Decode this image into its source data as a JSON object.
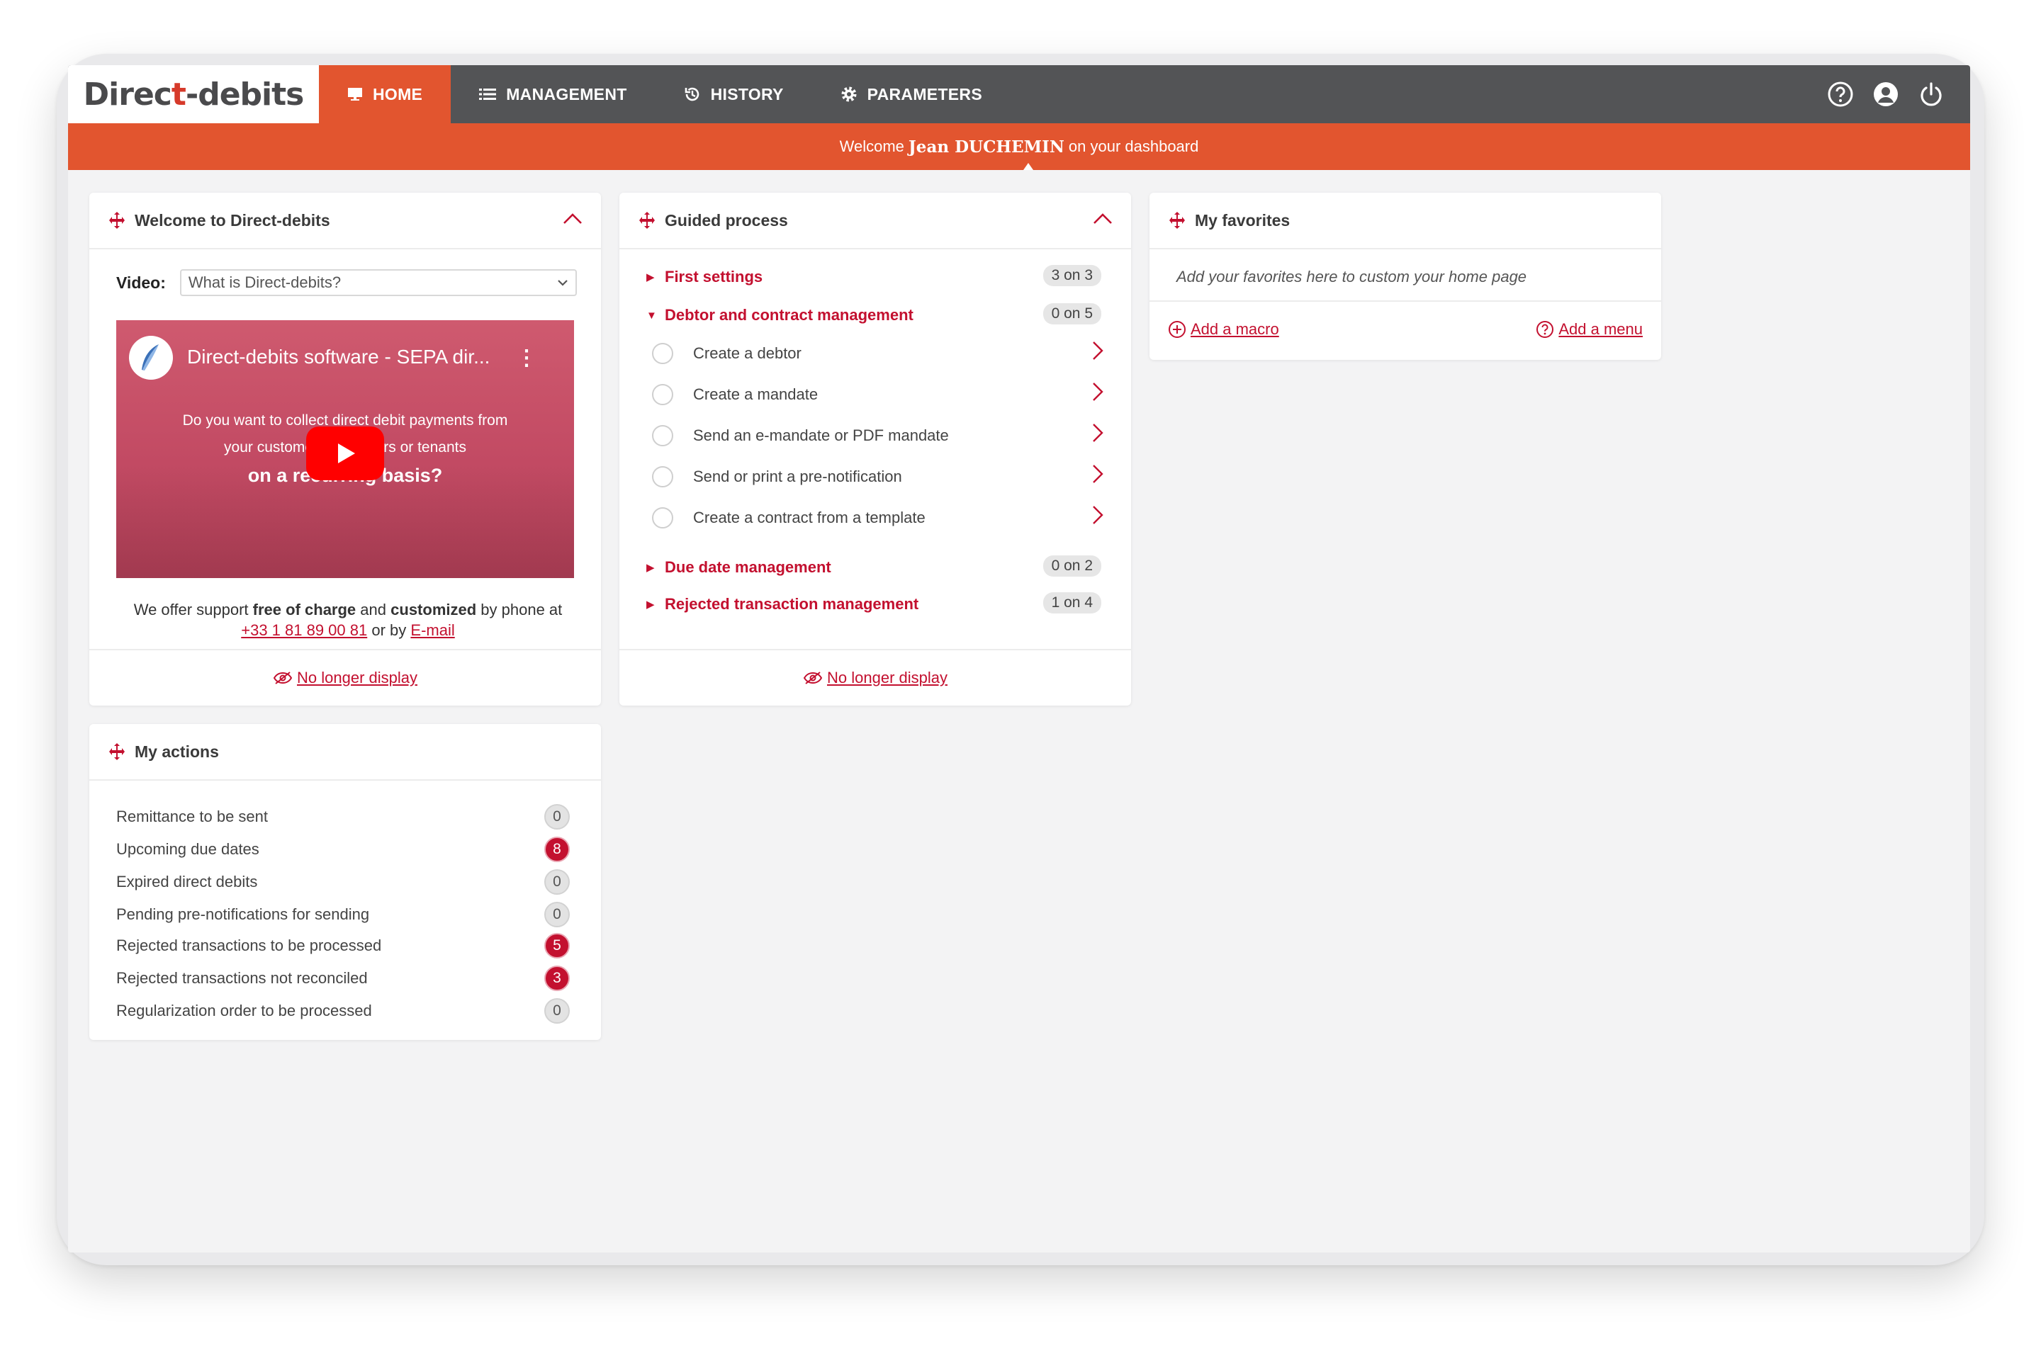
{
  "app": {
    "logo_a": "Direc",
    "logo_mark": "t",
    "logo_b": "-debits"
  },
  "nav": [
    {
      "label": "HOME",
      "icon": "monitor-icon",
      "active": true
    },
    {
      "label": "MANAGEMENT",
      "icon": "list-icon",
      "active": false
    },
    {
      "label": "HISTORY",
      "icon": "history-icon",
      "active": false
    },
    {
      "label": "PARAMETERS",
      "icon": "gear-icon",
      "active": false
    }
  ],
  "top_icons": [
    "help-icon",
    "user-icon",
    "power-icon"
  ],
  "welcome": {
    "prefix": "Welcome",
    "name": "Jean DUCHEMIN",
    "suffix": "on your dashboard"
  },
  "colors": {
    "accent": "#e2552f",
    "brand_red": "#c3102f",
    "topbar": "#535456"
  },
  "welcome_panel": {
    "title": "Welcome to Direct-debits",
    "video_label": "Video:",
    "video_selected": "What is Direct-debits?",
    "video_title": "Direct-debits software - SEPA dir...",
    "video_line1": "Do you want to collect direct debit payments from",
    "video_line2": "your customers, members or tenants",
    "video_line3": "on a recurring basis?",
    "support_1": "We offer support",
    "support_2": "free of charge",
    "support_3": "and",
    "support_4": "customized",
    "support_5": "by phone at",
    "phone": "+33 1 81 89 00 81",
    "support_6": "or by",
    "email": "E-mail",
    "footer_link": "No longer display"
  },
  "guided": {
    "title": "Guided process",
    "sections": [
      {
        "label": "First settings",
        "progress": "3 on 3"
      },
      {
        "label": "Debtor and contract management",
        "progress": "0 on 5"
      },
      {
        "label": "Due date management",
        "progress": "0 on 2"
      },
      {
        "label": "Rejected transaction management",
        "progress": "1 on 4"
      }
    ],
    "steps": [
      "Create a debtor",
      "Create a mandate",
      "Send an e-mandate or PDF mandate",
      "Send or print a pre-notification",
      "Create a contract from a template"
    ],
    "footer_link": "No longer display"
  },
  "favorites": {
    "title": "My favorites",
    "hint": "Add your favorites here to custom your home page",
    "add_macro": "Add a macro",
    "add_menu": "Add a menu"
  },
  "actions": {
    "title": "My actions",
    "items": [
      {
        "label": "Remittance to be sent",
        "count": "0"
      },
      {
        "label": "Upcoming due dates",
        "count": "8"
      },
      {
        "label": "Expired direct debits",
        "count": "0"
      },
      {
        "label": "Pending pre-notifications for sending",
        "count": "0"
      },
      {
        "label": "Rejected transactions to be processed",
        "count": "5"
      },
      {
        "label": "Rejected transactions not reconciled",
        "count": "3"
      },
      {
        "label": "Regularization order to be processed",
        "count": "0"
      }
    ]
  }
}
